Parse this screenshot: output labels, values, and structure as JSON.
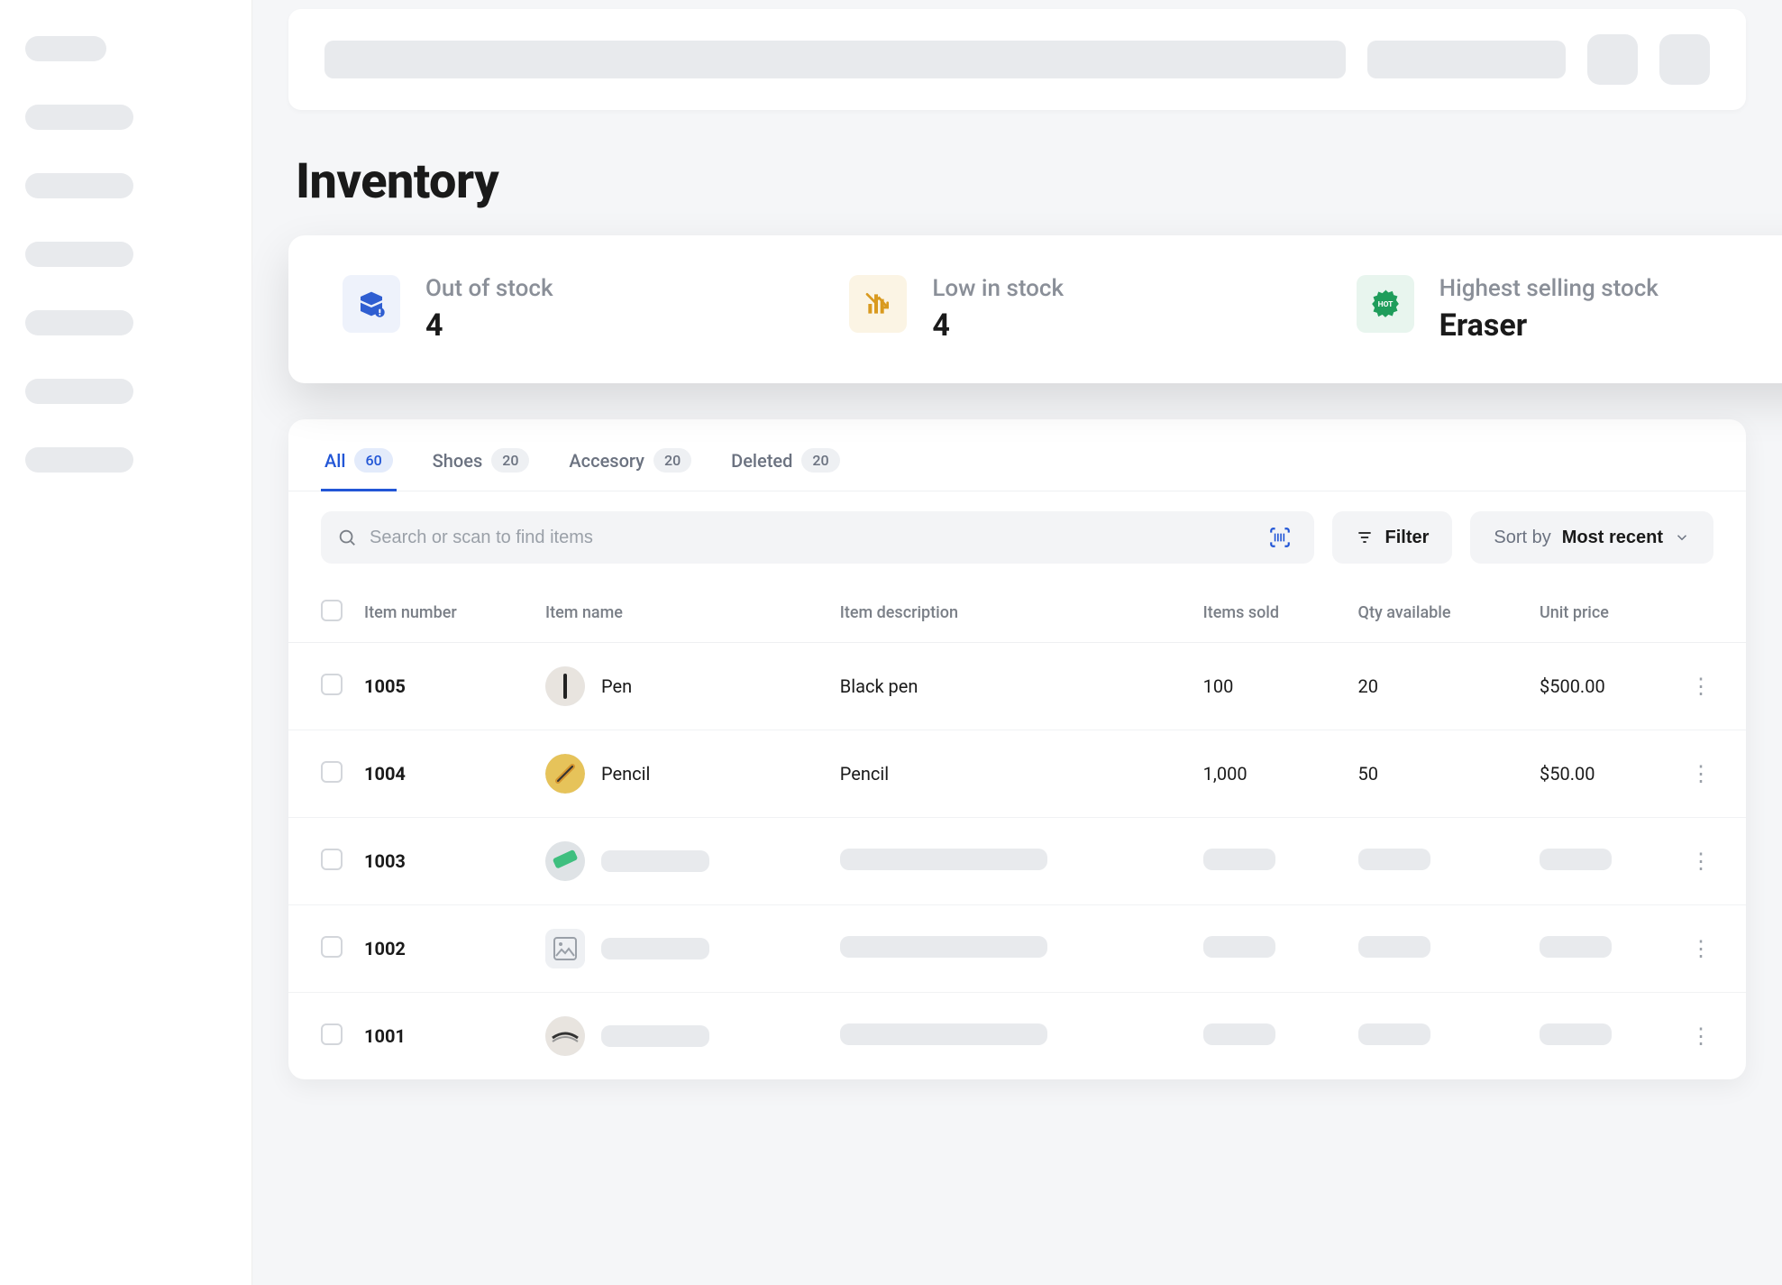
{
  "page": {
    "title": "Inventory"
  },
  "stats": [
    {
      "label": "Out of stock",
      "value": "4",
      "icon": "box-alert-icon",
      "tone": "blue"
    },
    {
      "label": "Low in stock",
      "value": "4",
      "icon": "trend-down-icon",
      "tone": "amber"
    },
    {
      "label": "Highest selling stock",
      "value": "Eraser",
      "icon": "hot-badge-icon",
      "tone": "green"
    }
  ],
  "tabs": [
    {
      "label": "All",
      "count": "60",
      "active": true
    },
    {
      "label": "Shoes",
      "count": "20",
      "active": false
    },
    {
      "label": "Accesory",
      "count": "20",
      "active": false
    },
    {
      "label": "Deleted",
      "count": "20",
      "active": false
    }
  ],
  "toolbar": {
    "search_placeholder": "Search or scan to find items",
    "filter_label": "Filter",
    "sort_prefix": "Sort by",
    "sort_value": "Most recent"
  },
  "table": {
    "columns": [
      "Item number",
      "Item name",
      "Item description",
      "Items sold",
      "Qty available",
      "Unit price"
    ],
    "rows": [
      {
        "number": "1005",
        "name": "Pen",
        "desc": "Black pen",
        "sold": "100",
        "qty": "20",
        "price": "$500.00",
        "thumb": "pen",
        "placeholder": false
      },
      {
        "number": "1004",
        "name": "Pencil",
        "desc": "Pencil",
        "sold": "1,000",
        "qty": "50",
        "price": "$50.00",
        "thumb": "pencil",
        "placeholder": false
      },
      {
        "number": "1003",
        "name": "",
        "desc": "",
        "sold": "",
        "qty": "",
        "price": "",
        "thumb": "green",
        "placeholder": true
      },
      {
        "number": "1002",
        "name": "",
        "desc": "",
        "sold": "",
        "qty": "",
        "price": "",
        "thumb": "img",
        "placeholder": true
      },
      {
        "number": "1001",
        "name": "",
        "desc": "",
        "sold": "",
        "qty": "",
        "price": "",
        "thumb": "bw",
        "placeholder": true
      }
    ]
  }
}
